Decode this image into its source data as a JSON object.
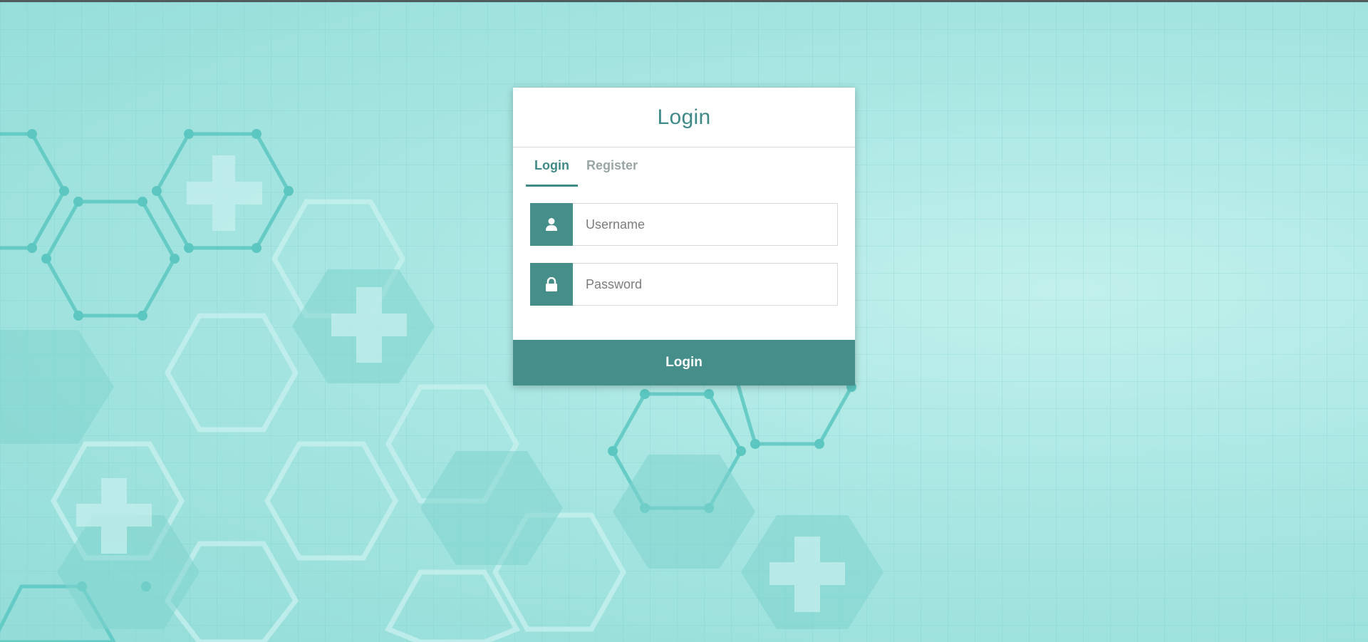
{
  "card": {
    "title": "Login",
    "tabs": [
      {
        "label": "Login",
        "active": true
      },
      {
        "label": "Register",
        "active": false
      }
    ],
    "username": {
      "placeholder": "Username",
      "value": "",
      "icon": "user-icon"
    },
    "password": {
      "placeholder": "Password",
      "value": "",
      "icon": "lock-icon"
    },
    "submit_label": "Login"
  },
  "colors": {
    "accent": "#468e89",
    "title": "#3f8a86",
    "inactive_tab": "#9aa5a5",
    "background": "#a3e3df"
  }
}
